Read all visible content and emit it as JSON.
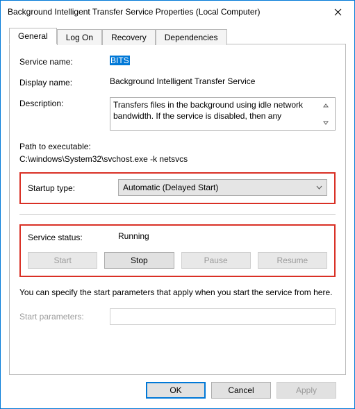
{
  "window": {
    "title": "Background Intelligent Transfer Service Properties (Local Computer)"
  },
  "tabs": {
    "general": "General",
    "logon": "Log On",
    "recovery": "Recovery",
    "dependencies": "Dependencies"
  },
  "labels": {
    "service_name": "Service name:",
    "display_name": "Display name:",
    "description": "Description:",
    "path_title": "Path to executable:",
    "startup_type": "Startup type:",
    "service_status": "Service status:",
    "start_parameters": "Start parameters:"
  },
  "values": {
    "service_name": "BITS",
    "display_name": "Background Intelligent Transfer Service",
    "description": "Transfers files in the background using idle network bandwidth. If the service is disabled, then any",
    "path": "C:\\windows\\System32\\svchost.exe -k netsvcs",
    "startup_type": "Automatic (Delayed Start)",
    "service_status": "Running",
    "start_parameters": ""
  },
  "buttons": {
    "start": "Start",
    "stop": "Stop",
    "pause": "Pause",
    "resume": "Resume",
    "ok": "OK",
    "cancel": "Cancel",
    "apply": "Apply"
  },
  "hint": "You can specify the start parameters that apply when you start the service from here."
}
